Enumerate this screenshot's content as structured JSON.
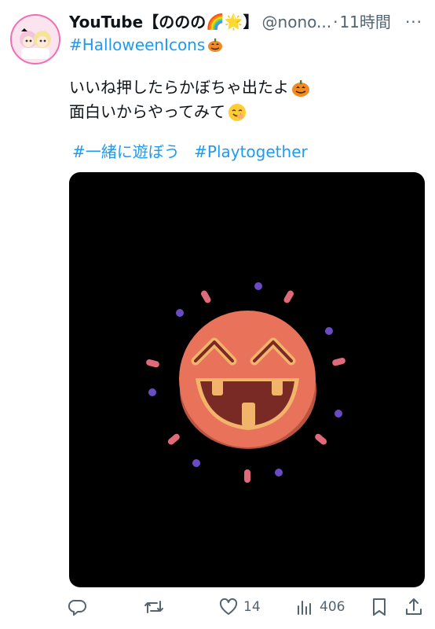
{
  "author": {
    "display_name": "YouTube【ののの",
    "display_name_suffix": "】",
    "handle": "@nono...",
    "separator": "·",
    "time": "11時間"
  },
  "header_hashtag": "#HalloweenIcons",
  "body": {
    "line1": "いいね押したらかぼちゃ出たよ",
    "line2": "面白いからやってみて"
  },
  "tags": [
    "#一緒に遊ぼう",
    "#Playtogether"
  ],
  "actions": {
    "likes": "14",
    "views": "406"
  },
  "colors": {
    "link": "#1d9bf0",
    "secondary_text": "#536471",
    "pumpkin": "#e8725a",
    "pumpkin_outline": "#f2b36a",
    "burst_pink": "#e06a7a",
    "burst_purple": "#6a4bc4"
  },
  "icons": [
    "rainbow-icon",
    "star-icon",
    "pumpkin-icon",
    "smile-icon",
    "reply-icon",
    "retweet-icon",
    "heart-icon",
    "views-icon",
    "bookmark-icon",
    "share-icon",
    "more-icon"
  ]
}
